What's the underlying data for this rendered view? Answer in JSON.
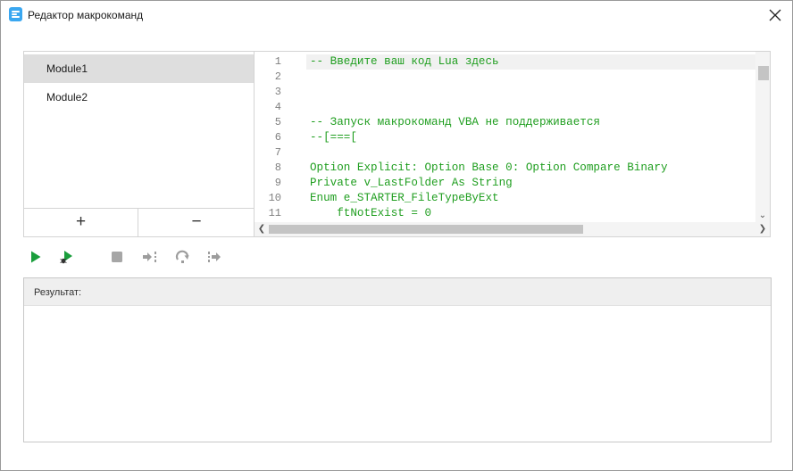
{
  "window": {
    "title": "Редактор макрокоманд"
  },
  "icons": {
    "app": "macro-editor-icon",
    "close": "close-icon",
    "add": "plus-icon",
    "remove": "minus-icon",
    "run": "play-icon",
    "debug": "debug-run-icon",
    "stop": "stop-icon",
    "step_into": "step-into-icon",
    "step_over": "step-over-icon",
    "step_out": "step-out-icon"
  },
  "modules": {
    "items": [
      {
        "label": "Module1",
        "selected": true
      },
      {
        "label": "Module2",
        "selected": false
      }
    ],
    "add_label": "+",
    "remove_label": "−"
  },
  "editor": {
    "line_numbers": [
      "1",
      "2",
      "3",
      "4",
      "5",
      "6",
      "7",
      "8",
      "9",
      "10",
      "11"
    ],
    "lines": [
      "-- Введите ваш код Lua здесь",
      "",
      "",
      "",
      "-- Запуск макрокоманд VBA не поддерживается",
      "--[===[",
      "",
      "Option Explicit: Option Base 0: Option Compare Binary",
      "Private v_LastFolder As String",
      "Enum e_STARTER_FileTypeByExt",
      "    ftNotExist = 0"
    ],
    "current_line": 1
  },
  "result": {
    "label": "Результат:"
  },
  "colors": {
    "code_text": "#1f9e1f",
    "selection": "#dedede",
    "run_green": "#1a9e3c",
    "disabled_gray": "#9d9d9d"
  }
}
